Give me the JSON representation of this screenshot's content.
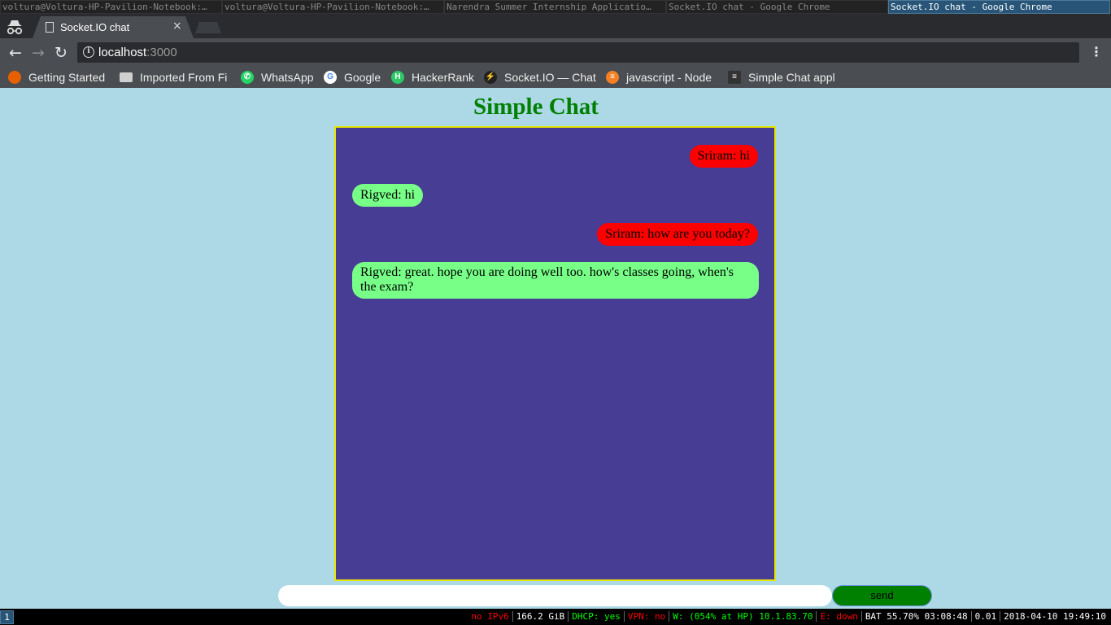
{
  "wm": {
    "tabs": [
      "voltura@Voltura-HP-Pavilion-Notebook:…",
      "voltura@Voltura-HP-Pavilion-Notebook:…",
      "Narendra Summer Internship Applicatio…",
      "Socket.IO chat - Google Chrome",
      "Socket.IO chat - Google Chrome"
    ]
  },
  "browser": {
    "tab_title": "Socket.IO chat",
    "close_glyph": "×",
    "url_host": "localhost",
    "url_port": ":3000",
    "bookmarks": [
      {
        "label": "Getting Started",
        "icon": "firefox-icon",
        "color": "#e66000"
      },
      {
        "label": "Imported From Fi",
        "icon": "folder-icon",
        "color": "#d0d0d0"
      },
      {
        "label": "WhatsApp",
        "icon": "whatsapp-icon",
        "color": "#25d366"
      },
      {
        "label": "Google",
        "icon": "google-icon",
        "color": "#ffffff"
      },
      {
        "label": "HackerRank",
        "icon": "hackerrank-icon",
        "color": "#2ec866"
      },
      {
        "label": "Socket.IO — Chat",
        "icon": "socketio-icon",
        "color": "#222222"
      },
      {
        "label": "javascript - Node",
        "icon": "stackoverflow-icon",
        "color": "#f48024"
      },
      {
        "label": "Simple Chat appl",
        "icon": "app-icon",
        "color": "#333333"
      }
    ]
  },
  "chat": {
    "title": "Simple Chat",
    "messages": [
      {
        "text": "Sriram: hi",
        "side": "sent"
      },
      {
        "text": "Rigved: hi",
        "side": "recv"
      },
      {
        "text": "Sriram: how are you today?",
        "side": "sent"
      },
      {
        "text": "Rigved: great. hope you are doing well too. how's classes going, when's the exam?",
        "side": "recv"
      }
    ],
    "input_value": "",
    "send_label": "send",
    "colors": {
      "sent": "#ff0000",
      "recv": "#77ff88",
      "box": "#483d94",
      "border": "#e6e600",
      "title": "#008000"
    }
  },
  "status": {
    "workspace": "1",
    "items": [
      {
        "text": "no IPv6",
        "color": "#ff0000"
      },
      {
        "text": "166.2 GiB",
        "color": "#ffffff"
      },
      {
        "text": "DHCP: yes",
        "color": "#00ff00"
      },
      {
        "text": "VPN: no",
        "color": "#ff0000"
      },
      {
        "text": "W: (054% at HP) 10.1.83.70",
        "color": "#00ff00"
      },
      {
        "text": "E: down",
        "color": "#ff0000"
      },
      {
        "text": "BAT 55.70% 03:08:48",
        "color": "#ffffff"
      },
      {
        "text": "0.01",
        "color": "#ffffff"
      },
      {
        "text": "2018-04-10 19:49:10",
        "color": "#ffffff"
      }
    ]
  }
}
